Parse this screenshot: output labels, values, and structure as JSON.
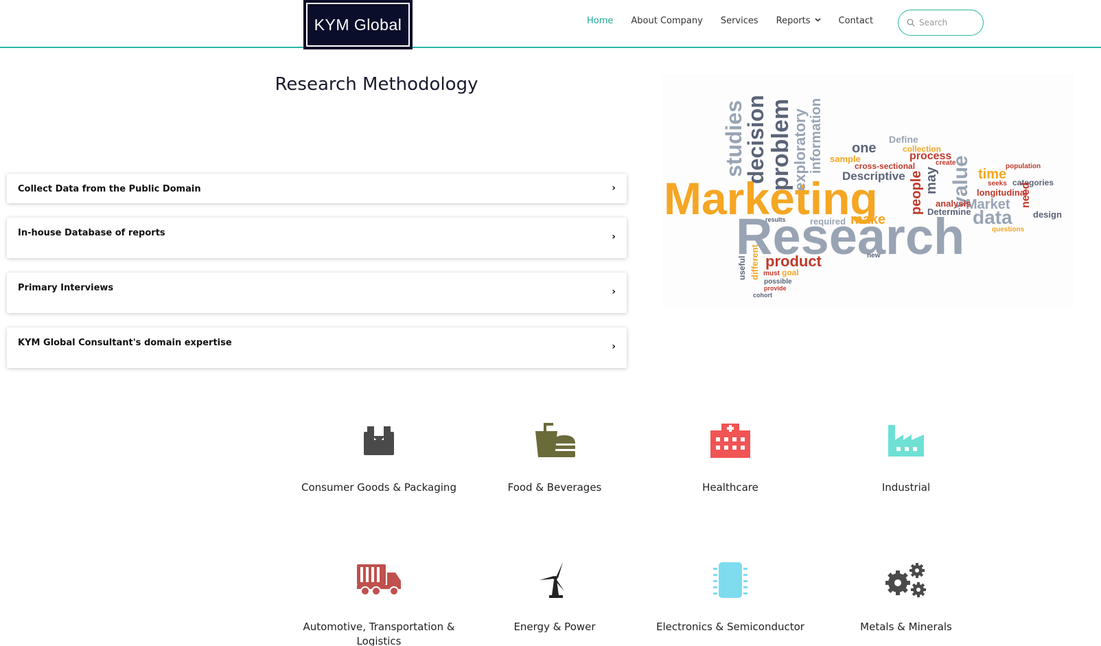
{
  "header": {
    "logo_text": "KYM Global",
    "nav": {
      "home": "Home",
      "about": "About Company",
      "services": "Services",
      "reports": "Reports",
      "contact": "Contact"
    },
    "search_placeholder": "Search"
  },
  "page_title": "Research Methodology",
  "accordion": [
    {
      "label": "Collect Data from the Public Domain"
    },
    {
      "label": "In-house Database of reports"
    },
    {
      "label": "Primary Interviews"
    },
    {
      "label": "KYM Global Consultant's domain expertise"
    }
  ],
  "word_cloud": {
    "big": [
      "Marketing",
      "Research"
    ],
    "words": [
      "studies",
      "decision",
      "problem",
      "exploratory",
      "information",
      "value",
      "Define",
      "one",
      "sample",
      "process",
      "collection",
      "cross-sectional",
      "Descriptive",
      "time",
      "categories",
      "population",
      "longitudinal",
      "Market",
      "data",
      "need",
      "design",
      "analysis",
      "Determine",
      "make",
      "required",
      "product",
      "goal",
      "must",
      "possible",
      "provide",
      "cohort",
      "different",
      "useful",
      "people",
      "may",
      "seeks",
      "questions",
      "results",
      "new",
      "create"
    ]
  },
  "industries": [
    {
      "label": "Consumer Goods & Packaging",
      "icon": "box-icon",
      "color": "#4a4a4a"
    },
    {
      "label": "Food & Beverages",
      "icon": "food-drink-icon",
      "color": "#6b6b3a"
    },
    {
      "label": "Healthcare",
      "icon": "hospital-icon",
      "color": "#f05454"
    },
    {
      "label": "Industrial",
      "icon": "factory-icon",
      "color": "#6fe0d4"
    },
    {
      "label": "Automotive, Transportation & Logistics",
      "icon": "truck-icon",
      "color": "#c0504d"
    },
    {
      "label": "Energy & Power",
      "icon": "wind-turbine-icon",
      "color": "#222222"
    },
    {
      "label": "Electronics & Semiconductor",
      "icon": "microchip-icon",
      "color": "#7fdcef"
    },
    {
      "label": "Metals & Minerals",
      "icon": "gears-icon",
      "color": "#4a4a4a"
    }
  ],
  "colors": {
    "accent": "#2bb5a5",
    "logo_bg": "#0b0e2a"
  }
}
